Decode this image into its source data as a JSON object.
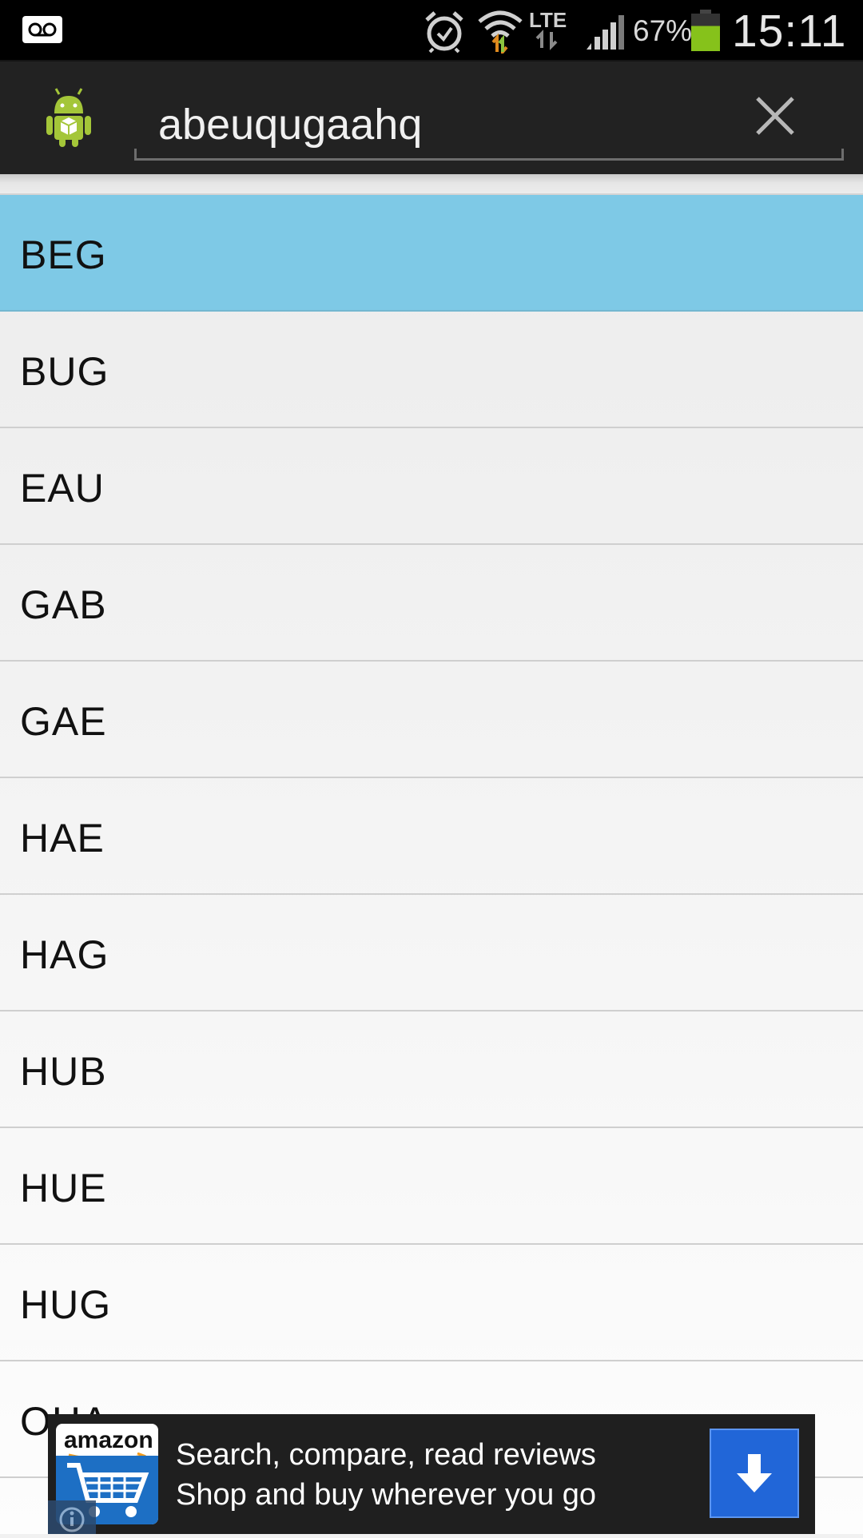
{
  "status_bar": {
    "battery_percent": "67%",
    "battery_level": 0.67,
    "time": "15:11",
    "icons": [
      "voicemail-icon",
      "alarm-icon",
      "wifi-icon",
      "lte-icon",
      "signal-icon",
      "battery-icon"
    ],
    "battery_color": "#86c21b"
  },
  "search": {
    "query": "abeuqugaahq",
    "icons": [
      "android-app-icon",
      "close-icon"
    ]
  },
  "list": {
    "selected_color": "#7ec9e6",
    "items": [
      {
        "label": "BEG",
        "selected": true
      },
      {
        "label": "BUG"
      },
      {
        "label": "EAU"
      },
      {
        "label": "GAB"
      },
      {
        "label": "GAE"
      },
      {
        "label": "HAE"
      },
      {
        "label": "HAG"
      },
      {
        "label": "HUB"
      },
      {
        "label": "HUE"
      },
      {
        "label": "HUG"
      },
      {
        "label": "OHA"
      }
    ]
  },
  "ad": {
    "logo_text": "amazon",
    "text": "Search, compare, read reviews Shop and buy wherever you go",
    "icons": [
      "amazon-cart-logo",
      "info-icon",
      "download-arrow-icon"
    ],
    "button_color": "#2166d8"
  }
}
